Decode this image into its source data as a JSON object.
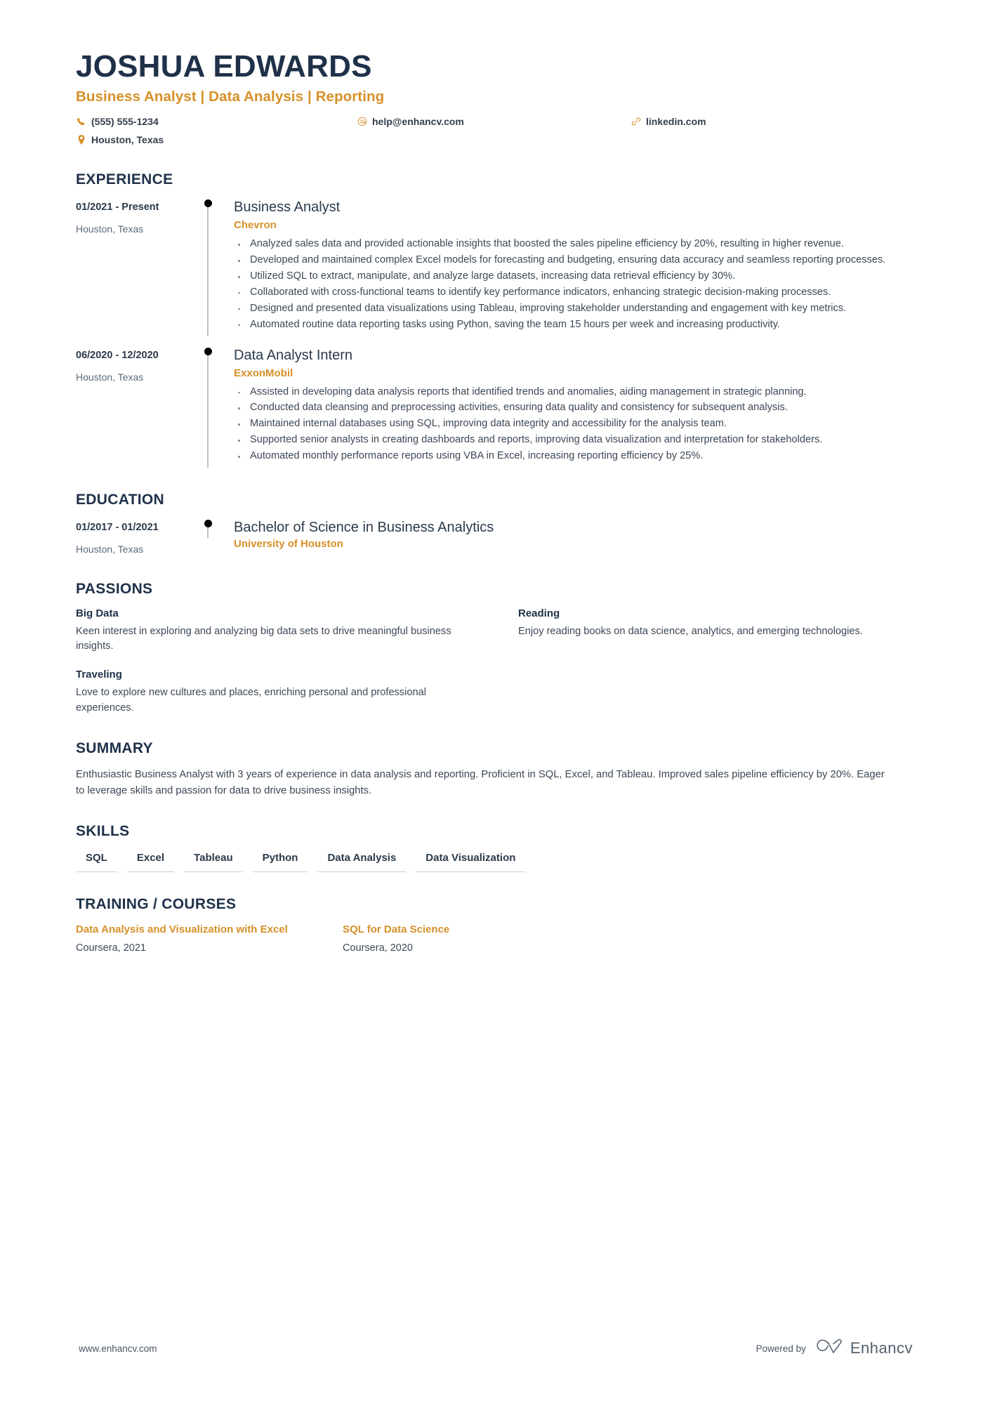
{
  "header": {
    "name": "JOSHUA EDWARDS",
    "headline": "Business Analyst | Data Analysis | Reporting",
    "contacts": [
      {
        "icon": "phone-icon",
        "text": "(555) 555-1234"
      },
      {
        "icon": "email-icon",
        "text": "help@enhancv.com"
      },
      {
        "icon": "link-icon",
        "text": "linkedin.com"
      },
      {
        "icon": "location-pin-icon",
        "text": "Houston, Texas"
      }
    ]
  },
  "sections": {
    "experience": {
      "title": "EXPERIENCE"
    },
    "education": {
      "title": "EDUCATION"
    },
    "passions": {
      "title": "PASSIONS"
    },
    "summary": {
      "title": "SUMMARY"
    },
    "skills": {
      "title": "SKILLS"
    },
    "training": {
      "title": "TRAINING / COURSES"
    }
  },
  "experience": [
    {
      "date": "01/2021 - Present",
      "location": "Houston, Texas",
      "role": "Business Analyst",
      "company": "Chevron",
      "bullets": [
        "Analyzed sales data and provided actionable insights that boosted the sales pipeline efficiency by 20%, resulting in higher revenue.",
        "Developed and maintained complex Excel models for forecasting and budgeting, ensuring data accuracy and seamless reporting processes.",
        "Utilized SQL to extract, manipulate, and analyze large datasets, increasing data retrieval efficiency by 30%.",
        "Collaborated with cross-functional teams to identify key performance indicators, enhancing strategic decision-making processes.",
        "Designed and presented data visualizations using Tableau, improving stakeholder understanding and engagement with key metrics.",
        "Automated routine data reporting tasks using Python, saving the team 15 hours per week and increasing productivity."
      ]
    },
    {
      "date": "06/2020 - 12/2020",
      "location": "Houston, Texas",
      "role": "Data Analyst Intern",
      "company": "ExxonMobil",
      "bullets": [
        "Assisted in developing data analysis reports that identified trends and anomalies, aiding management in strategic planning.",
        "Conducted data cleansing and preprocessing activities, ensuring data quality and consistency for subsequent analysis.",
        "Maintained internal databases using SQL, improving data integrity and accessibility for the analysis team.",
        "Supported senior analysts in creating dashboards and reports, improving data visualization and interpretation for stakeholders.",
        "Automated monthly performance reports using VBA in Excel, increasing reporting efficiency by 25%."
      ]
    }
  ],
  "education": [
    {
      "date": "01/2017 - 01/2021",
      "location": "Houston, Texas",
      "degree": "Bachelor of Science in Business Analytics",
      "school": "University of Houston"
    }
  ],
  "passions": [
    {
      "title": "Big Data",
      "description": "Keen interest in exploring and analyzing big data sets to drive meaningful business insights."
    },
    {
      "title": "Reading",
      "description": "Enjoy reading books on data science, analytics, and emerging technologies."
    },
    {
      "title": "Traveling",
      "description": "Love to explore new cultures and places, enriching personal and professional experiences."
    }
  ],
  "summary": {
    "text": "Enthusiastic Business Analyst with 3 years of experience in data analysis and reporting. Proficient in SQL, Excel, and Tableau. Improved sales pipeline efficiency by 20%. Eager to leverage skills and passion for data to drive business insights."
  },
  "skills": [
    "SQL",
    "Excel",
    "Tableau",
    "Python",
    "Data Analysis",
    "Data Visualization"
  ],
  "training": [
    {
      "title": "Data Analysis and Visualization with Excel",
      "meta": "Coursera, 2021"
    },
    {
      "title": "SQL for Data Science",
      "meta": "Coursera, 2020"
    }
  ],
  "footer": {
    "url": "www.enhancv.com",
    "powered_by": "Powered by",
    "brand": "Enhancv"
  },
  "colors": {
    "accent": "#d79028",
    "heading": "#1f3149",
    "body": "#3c4856",
    "rail": "#bcc3ca"
  }
}
